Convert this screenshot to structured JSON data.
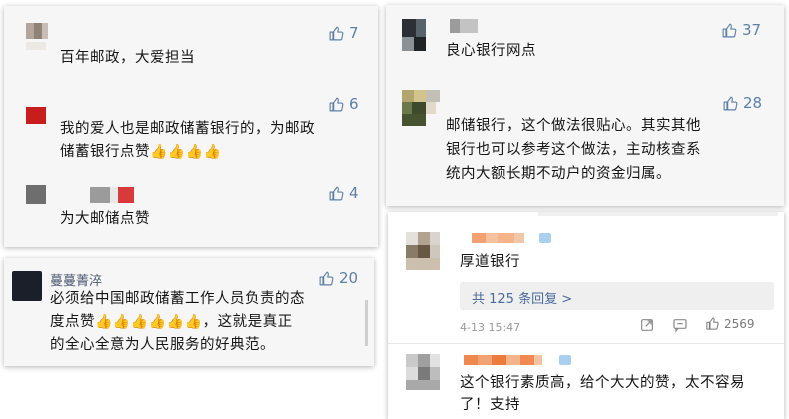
{
  "panel1": {
    "comments": [
      {
        "text": "百年邮政，大爱担当",
        "likes": "7"
      },
      {
        "text_line1": "我的爱人也是邮政储蓄银行的，为邮政",
        "text_line2": "储蓄银行点赞",
        "thumbs": "👍👍👍👍",
        "likes": "6"
      },
      {
        "text": "为大邮储点赞",
        "likes": "4"
      }
    ]
  },
  "panel2": {
    "comments": [
      {
        "text": "良心银行网点",
        "likes": "37"
      },
      {
        "text_line1": "邮储银行，这个做法很贴心。其实其他",
        "text_line2": "银行也可以参考这个做法，主动核查系",
        "text_line3": "统内大额长期不动户的资金归属。",
        "likes": "28"
      }
    ]
  },
  "panel3": {
    "user": "蔓蔓菁淬",
    "likes": "20",
    "text_line1": "必须给中国邮政储蓄工作人员负责的态",
    "text_line2_prefix": "度点赞",
    "thumbs": "👍👍👍👍👍👍",
    "text_line2_suffix": "，这就是真正",
    "text_line3": "的全心全意为人民服务的好典范。"
  },
  "panel4": {
    "comment1": {
      "text": "厚道银行",
      "replies": "共 125 条回复 >",
      "date": "4-13 15:47",
      "likes": "2569"
    },
    "comment2": {
      "text_line1": "这个银行素质高，给个大大的赞，太不容易",
      "text_line2": "了！支持"
    }
  },
  "icons": {
    "like": "thumbs-up-outline-icon",
    "share": "share-icon",
    "comment": "comment-icon"
  },
  "colors": {
    "like_blue": "#5d7fa8",
    "link_blue": "#4a6a9a",
    "card_bg": "#f6f6f6"
  }
}
